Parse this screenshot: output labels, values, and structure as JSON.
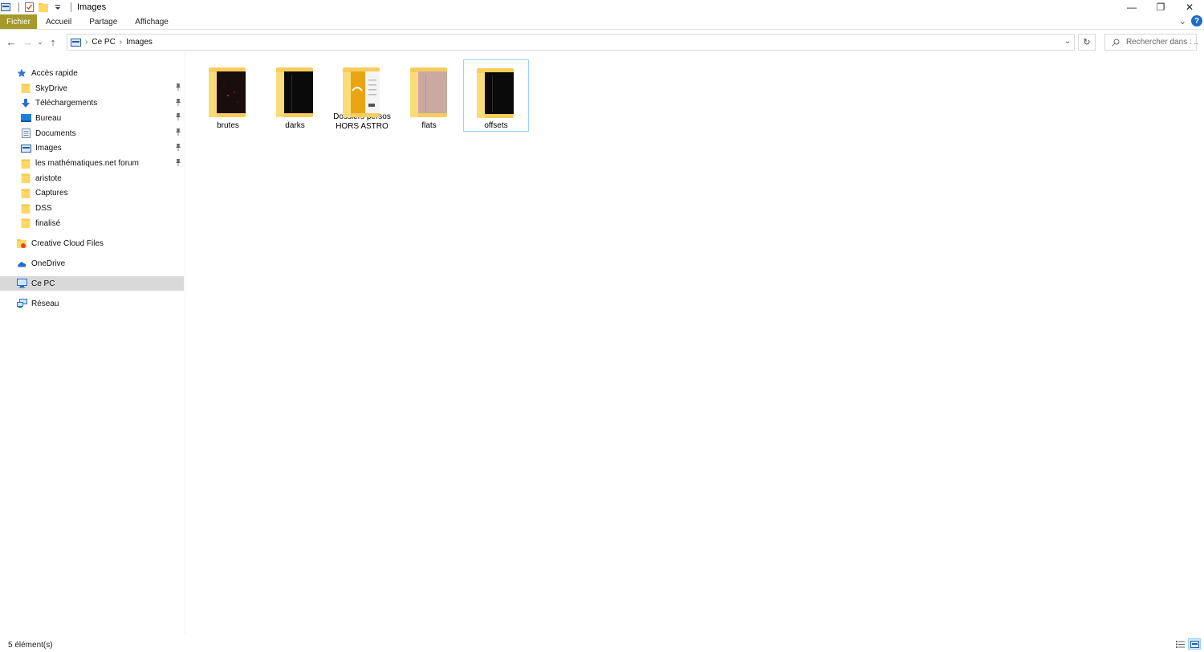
{
  "window": {
    "title": "Images",
    "minimize": "—",
    "restore": "❐",
    "close": "✕"
  },
  "ribbon": {
    "tabs": [
      "Fichier",
      "Accueil",
      "Partage",
      "Affichage"
    ],
    "expand": "⌄",
    "help": "?"
  },
  "nav": {
    "back": "←",
    "forward": "→",
    "recent": "⌄",
    "up": "↑",
    "breadcrumb": [
      "Ce PC",
      "Images"
    ],
    "crumb_sep": "›",
    "dropdown": "⌄",
    "refresh": "↻",
    "search_placeholder": "Rechercher dans : ..."
  },
  "navpane": {
    "quick_access": "Accès rapide",
    "pinned": [
      {
        "label": "SkyDrive",
        "icon": "folder-icon",
        "pinned": true
      },
      {
        "label": "Téléchargements",
        "icon": "download-icon",
        "pinned": true
      },
      {
        "label": "Bureau",
        "icon": "desktop-icon",
        "pinned": true
      },
      {
        "label": "Documents",
        "icon": "documents-icon",
        "pinned": true
      },
      {
        "label": "Images",
        "icon": "pictures-icon",
        "pinned": true
      },
      {
        "label": "les mathématiques.net forum",
        "icon": "folder-icon",
        "pinned": true
      },
      {
        "label": "aristote",
        "icon": "folder-icon",
        "pinned": false
      },
      {
        "label": "Captures",
        "icon": "folder-icon",
        "pinned": false
      },
      {
        "label": "DSS",
        "icon": "folder-icon",
        "pinned": false
      },
      {
        "label": "finalisé",
        "icon": "folder-icon",
        "pinned": false
      }
    ],
    "creative_cloud": "Creative Cloud Files",
    "onedrive": "OneDrive",
    "this_pc": "Ce PC",
    "network": "Réseau",
    "pin_glyph": "📌"
  },
  "content": {
    "folders": [
      {
        "name": "brutes",
        "preview": "dark-stars"
      },
      {
        "name": "darks",
        "preview": "black"
      },
      {
        "name": "Dossiers persos HORS ASTRO",
        "preview": "document"
      },
      {
        "name": "flats",
        "preview": "pinkish"
      },
      {
        "name": "offsets",
        "preview": "black",
        "selected": true
      }
    ]
  },
  "status": {
    "count": "5 élément(s)"
  },
  "colors": {
    "file_tab": "#a59a2a",
    "selection": "#cce8ff",
    "folder": "#f6cd5d",
    "help": "#1b6dcc"
  }
}
